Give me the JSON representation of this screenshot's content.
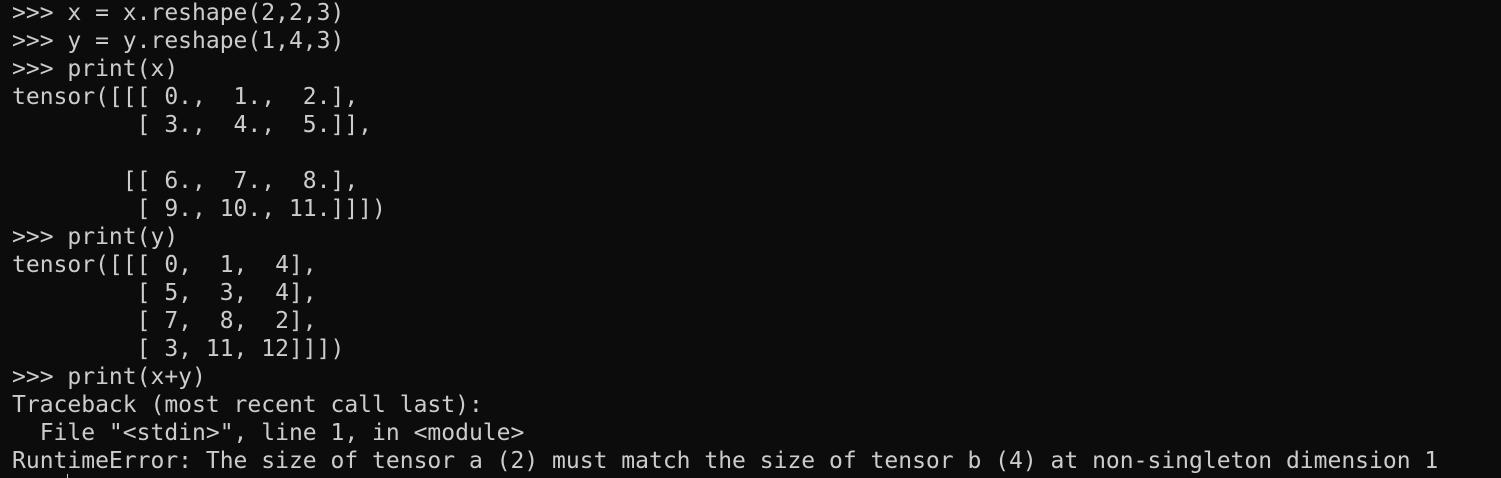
{
  "terminal": {
    "lines": [
      ">>> x = x.reshape(2,2,3)",
      ">>> y = y.reshape(1,4,3)",
      ">>> print(x)",
      "tensor([[[ 0.,  1.,  2.],",
      "         [ 3.,  4.,  5.]],",
      "",
      "        [[ 6.,  7.,  8.],",
      "         [ 9., 10., 11.]]])",
      ">>> print(y)",
      "tensor([[[ 0,  1,  4],",
      "         [ 5,  3,  4],",
      "         [ 7,  8,  2],",
      "         [ 3, 11, 12]]])",
      ">>> print(x+y)",
      "Traceback (most recent call last):",
      "  File \"<stdin>\", line 1, in <module>",
      "RuntimeError: The size of tensor a (2) must match the size of tensor b (4) at non-singleton dimension 1"
    ]
  }
}
